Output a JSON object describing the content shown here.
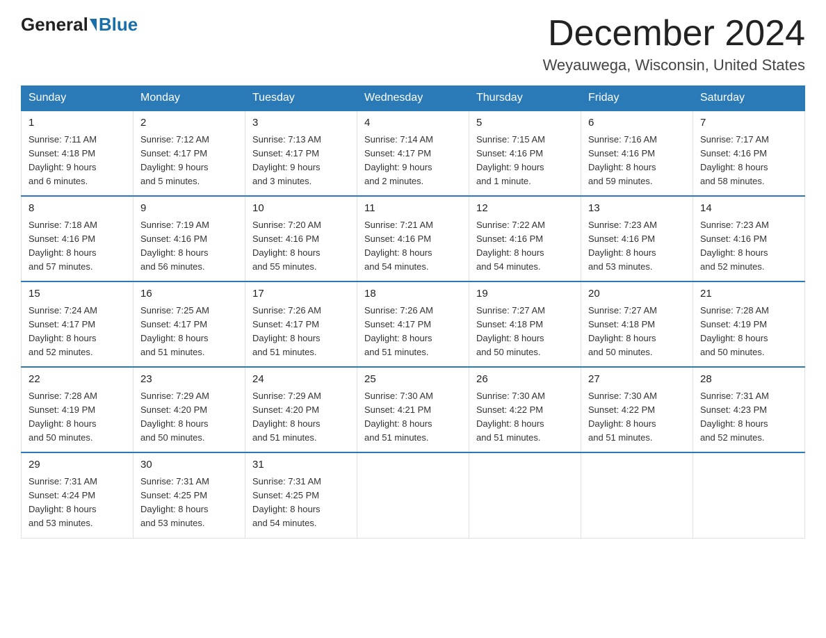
{
  "header": {
    "logo_general": "General",
    "logo_blue": "Blue",
    "month_title": "December 2024",
    "location": "Weyauwega, Wisconsin, United States"
  },
  "weekdays": [
    "Sunday",
    "Monday",
    "Tuesday",
    "Wednesday",
    "Thursday",
    "Friday",
    "Saturday"
  ],
  "weeks": [
    [
      {
        "day": "1",
        "sunrise": "7:11 AM",
        "sunset": "4:18 PM",
        "daylight": "9 hours and 6 minutes."
      },
      {
        "day": "2",
        "sunrise": "7:12 AM",
        "sunset": "4:17 PM",
        "daylight": "9 hours and 5 minutes."
      },
      {
        "day": "3",
        "sunrise": "7:13 AM",
        "sunset": "4:17 PM",
        "daylight": "9 hours and 3 minutes."
      },
      {
        "day": "4",
        "sunrise": "7:14 AM",
        "sunset": "4:17 PM",
        "daylight": "9 hours and 2 minutes."
      },
      {
        "day": "5",
        "sunrise": "7:15 AM",
        "sunset": "4:16 PM",
        "daylight": "9 hours and 1 minute."
      },
      {
        "day": "6",
        "sunrise": "7:16 AM",
        "sunset": "4:16 PM",
        "daylight": "8 hours and 59 minutes."
      },
      {
        "day": "7",
        "sunrise": "7:17 AM",
        "sunset": "4:16 PM",
        "daylight": "8 hours and 58 minutes."
      }
    ],
    [
      {
        "day": "8",
        "sunrise": "7:18 AM",
        "sunset": "4:16 PM",
        "daylight": "8 hours and 57 minutes."
      },
      {
        "day": "9",
        "sunrise": "7:19 AM",
        "sunset": "4:16 PM",
        "daylight": "8 hours and 56 minutes."
      },
      {
        "day": "10",
        "sunrise": "7:20 AM",
        "sunset": "4:16 PM",
        "daylight": "8 hours and 55 minutes."
      },
      {
        "day": "11",
        "sunrise": "7:21 AM",
        "sunset": "4:16 PM",
        "daylight": "8 hours and 54 minutes."
      },
      {
        "day": "12",
        "sunrise": "7:22 AM",
        "sunset": "4:16 PM",
        "daylight": "8 hours and 54 minutes."
      },
      {
        "day": "13",
        "sunrise": "7:23 AM",
        "sunset": "4:16 PM",
        "daylight": "8 hours and 53 minutes."
      },
      {
        "day": "14",
        "sunrise": "7:23 AM",
        "sunset": "4:16 PM",
        "daylight": "8 hours and 52 minutes."
      }
    ],
    [
      {
        "day": "15",
        "sunrise": "7:24 AM",
        "sunset": "4:17 PM",
        "daylight": "8 hours and 52 minutes."
      },
      {
        "day": "16",
        "sunrise": "7:25 AM",
        "sunset": "4:17 PM",
        "daylight": "8 hours and 51 minutes."
      },
      {
        "day": "17",
        "sunrise": "7:26 AM",
        "sunset": "4:17 PM",
        "daylight": "8 hours and 51 minutes."
      },
      {
        "day": "18",
        "sunrise": "7:26 AM",
        "sunset": "4:17 PM",
        "daylight": "8 hours and 51 minutes."
      },
      {
        "day": "19",
        "sunrise": "7:27 AM",
        "sunset": "4:18 PM",
        "daylight": "8 hours and 50 minutes."
      },
      {
        "day": "20",
        "sunrise": "7:27 AM",
        "sunset": "4:18 PM",
        "daylight": "8 hours and 50 minutes."
      },
      {
        "day": "21",
        "sunrise": "7:28 AM",
        "sunset": "4:19 PM",
        "daylight": "8 hours and 50 minutes."
      }
    ],
    [
      {
        "day": "22",
        "sunrise": "7:28 AM",
        "sunset": "4:19 PM",
        "daylight": "8 hours and 50 minutes."
      },
      {
        "day": "23",
        "sunrise": "7:29 AM",
        "sunset": "4:20 PM",
        "daylight": "8 hours and 50 minutes."
      },
      {
        "day": "24",
        "sunrise": "7:29 AM",
        "sunset": "4:20 PM",
        "daylight": "8 hours and 51 minutes."
      },
      {
        "day": "25",
        "sunrise": "7:30 AM",
        "sunset": "4:21 PM",
        "daylight": "8 hours and 51 minutes."
      },
      {
        "day": "26",
        "sunrise": "7:30 AM",
        "sunset": "4:22 PM",
        "daylight": "8 hours and 51 minutes."
      },
      {
        "day": "27",
        "sunrise": "7:30 AM",
        "sunset": "4:22 PM",
        "daylight": "8 hours and 51 minutes."
      },
      {
        "day": "28",
        "sunrise": "7:31 AM",
        "sunset": "4:23 PM",
        "daylight": "8 hours and 52 minutes."
      }
    ],
    [
      {
        "day": "29",
        "sunrise": "7:31 AM",
        "sunset": "4:24 PM",
        "daylight": "8 hours and 53 minutes."
      },
      {
        "day": "30",
        "sunrise": "7:31 AM",
        "sunset": "4:25 PM",
        "daylight": "8 hours and 53 minutes."
      },
      {
        "day": "31",
        "sunrise": "7:31 AM",
        "sunset": "4:25 PM",
        "daylight": "8 hours and 54 minutes."
      },
      null,
      null,
      null,
      null
    ]
  ],
  "labels": {
    "sunrise": "Sunrise:",
    "sunset": "Sunset:",
    "daylight": "Daylight:"
  }
}
